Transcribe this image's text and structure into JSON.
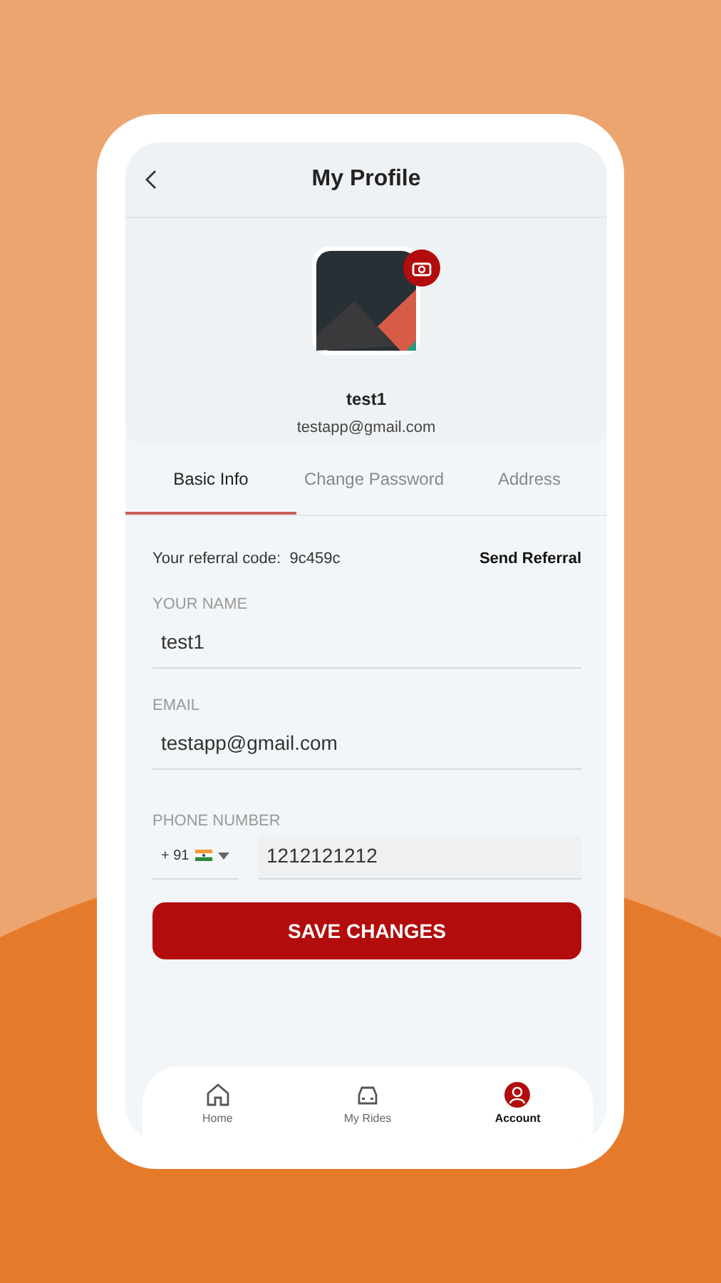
{
  "header": {
    "title": "My Profile"
  },
  "profile": {
    "name": "test1",
    "email": "testapp@gmail.com"
  },
  "tabs": [
    {
      "label": "Basic Info",
      "selected": true
    },
    {
      "label": "Change Password",
      "selected": false
    },
    {
      "label": "Address",
      "selected": false
    }
  ],
  "referral": {
    "label": "Your referral code:",
    "code": "9c459c",
    "action": "Send Referral"
  },
  "fields": [
    {
      "kind": "text",
      "label": "YOUR NAME",
      "value": "test1"
    },
    {
      "kind": "text",
      "label": "EMAIL",
      "value": "testapp@gmail.com"
    },
    {
      "kind": "phone",
      "label": "PHONE NUMBER",
      "country_code": "+ 91",
      "value": "1212121212"
    }
  ],
  "save_button": "SAVE CHANGES",
  "nav": [
    {
      "kind": "home",
      "label": "Home",
      "selected": false
    },
    {
      "kind": "car",
      "label": "My Rides",
      "selected": false
    },
    {
      "kind": "account",
      "label": "Account",
      "selected": true
    }
  ]
}
